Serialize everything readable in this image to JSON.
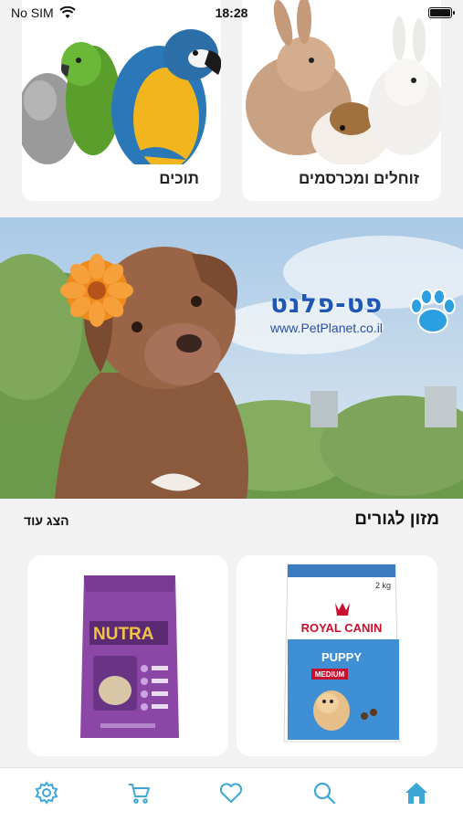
{
  "status_bar": {
    "carrier": "No SIM",
    "time": "18:28"
  },
  "categories": [
    {
      "label": "תוכים",
      "icon": "parrots-image"
    },
    {
      "label": "זוחלים ומכרסמים",
      "icon": "rabbits-image"
    }
  ],
  "banner": {
    "brand_hebrew": "פט-פלנט",
    "brand_url": "www.PetPlanet.co.il"
  },
  "section": {
    "title": "מזון לגורים",
    "show_more": "הצג עוד"
  },
  "products": [
    {
      "icon": "nutra-gold-puppy-bag",
      "brand": "NUTRA"
    },
    {
      "icon": "royal-canin-puppy-bag",
      "brand": "ROYAL CANIN",
      "line": "PUPPY",
      "size": "MEDIUM",
      "weight": "2 kg"
    }
  ],
  "tab_bar": {
    "items": [
      "settings-icon",
      "cart-icon",
      "heart-icon",
      "search-icon",
      "home-icon"
    ],
    "active": "home-icon"
  },
  "colors": {
    "accent": "#3da7d8",
    "background": "#f2f2f2"
  }
}
